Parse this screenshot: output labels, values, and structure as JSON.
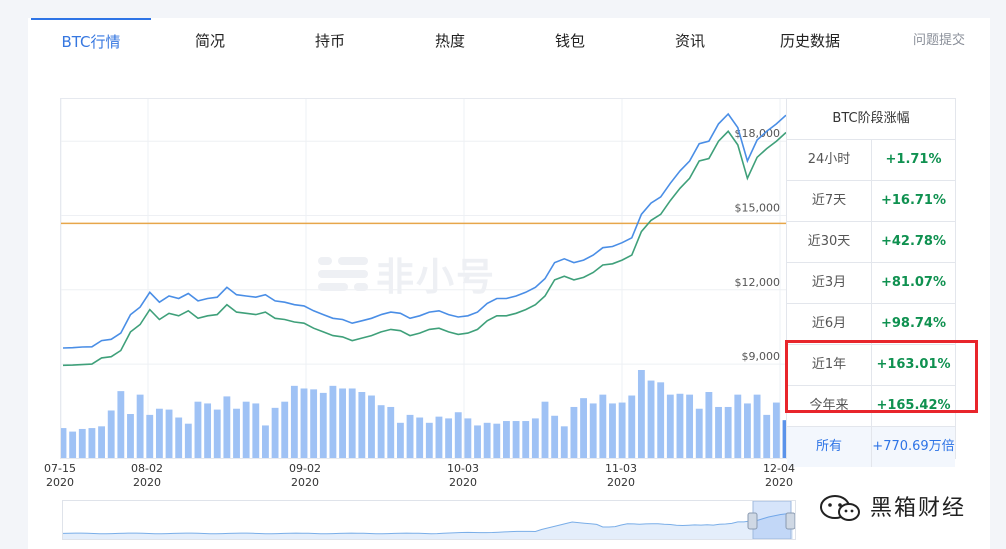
{
  "tabs": [
    {
      "label": "BTC行情",
      "active": true
    },
    {
      "label": "简况"
    },
    {
      "label": "持币"
    },
    {
      "label": "热度"
    },
    {
      "label": "钱包"
    },
    {
      "label": "资讯"
    },
    {
      "label": "历史数据"
    }
  ],
  "help_link": "问题提交",
  "watermark": "非小号",
  "performance": {
    "title": "BTC阶段涨幅",
    "rows": [
      {
        "label": "24小时",
        "value": "+1.71%"
      },
      {
        "label": "近7天",
        "value": "+16.71%"
      },
      {
        "label": "近30天",
        "value": "+42.78%"
      },
      {
        "label": "近3月",
        "value": "+81.07%"
      },
      {
        "label": "近6月",
        "value": "+98.74%"
      },
      {
        "label": "近1年",
        "value": "+163.01%"
      },
      {
        "label": "今年来",
        "value": "+165.42%"
      },
      {
        "label": "所有",
        "value": "+770.69万倍"
      }
    ],
    "highlighted_rows": [
      "近1年",
      "今年来"
    ],
    "highlight_color": "#e8252b",
    "positive_color": "#0f9150"
  },
  "brand": "黑箱财经",
  "colors": {
    "price_line": "#4a8ee6",
    "secondary_line": "#3fa07a",
    "reference_line": "#e7a64a",
    "volume_bar": "#9fc2f5",
    "volume_bar_last": "#5b93ea",
    "accent": "#2e74e6"
  },
  "chart_data": {
    "type": "line",
    "title": "",
    "y_ticks": [
      "$9,000",
      "$12,000",
      "$15,000",
      "$18,000"
    ],
    "ylim": [
      8600,
      19300
    ],
    "x_ticks": [
      {
        "date": "07-15",
        "year": "2020"
      },
      {
        "date": "08-02",
        "year": "2020"
      },
      {
        "date": "09-02",
        "year": "2020"
      },
      {
        "date": "10-03",
        "year": "2020"
      },
      {
        "date": "11-03",
        "year": "2020"
      },
      {
        "date": "12-04",
        "year": "2020"
      }
    ],
    "reference_level": 14680,
    "series": [
      {
        "values": [
          9650,
          9660,
          9690,
          9700,
          9950,
          10000,
          10250,
          11000,
          11300,
          11900,
          11500,
          11750,
          11650,
          11850,
          11550,
          11650,
          11700,
          12100,
          11800,
          11750,
          11700,
          11800,
          11550,
          11500,
          11400,
          11350,
          11150,
          11000,
          10850,
          10800,
          10650,
          10750,
          10850,
          11000,
          11100,
          11050,
          10850,
          10950,
          11100,
          11150,
          11000,
          10900,
          10950,
          11100,
          11450,
          11650,
          11650,
          11750,
          11900,
          12100,
          12450,
          13100,
          13250,
          13100,
          13200,
          13400,
          13700,
          13750,
          13900,
          14100,
          15050,
          15500,
          15750,
          16300,
          16800,
          17200,
          17900,
          18000,
          18700,
          19100,
          18550,
          17200,
          18050,
          18400,
          18700,
          19050
        ]
      },
      {
        "values": [
          8950,
          8960,
          8980,
          9000,
          9250,
          9300,
          9550,
          10300,
          10600,
          11200,
          10800,
          11050,
          10950,
          11150,
          10850,
          10950,
          11000,
          11400,
          11100,
          11050,
          11000,
          11100,
          10850,
          10800,
          10700,
          10650,
          10450,
          10300,
          10150,
          10100,
          9950,
          10050,
          10150,
          10300,
          10400,
          10350,
          10150,
          10250,
          10400,
          10450,
          10300,
          10200,
          10250,
          10400,
          10750,
          10950,
          10950,
          11050,
          11200,
          11400,
          11750,
          12400,
          12550,
          12400,
          12500,
          12700,
          13000,
          13050,
          13200,
          13400,
          14350,
          14800,
          15050,
          15600,
          16100,
          16500,
          17200,
          17300,
          18000,
          18400,
          17850,
          16500,
          17350,
          17700,
          18000,
          18350
        ]
      }
    ],
    "volume": [
      0.34,
      0.3,
      0.33,
      0.34,
      0.36,
      0.54,
      0.76,
      0.5,
      0.72,
      0.49,
      0.56,
      0.55,
      0.46,
      0.39,
      0.64,
      0.62,
      0.55,
      0.7,
      0.56,
      0.64,
      0.62,
      0.37,
      0.57,
      0.64,
      0.82,
      0.79,
      0.78,
      0.74,
      0.82,
      0.79,
      0.79,
      0.75,
      0.71,
      0.6,
      0.58,
      0.4,
      0.49,
      0.46,
      0.4,
      0.47,
      0.45,
      0.52,
      0.45,
      0.37,
      0.4,
      0.39,
      0.42,
      0.42,
      0.42,
      0.45,
      0.64,
      0.48,
      0.36,
      0.58,
      0.68,
      0.62,
      0.72,
      0.62,
      0.63,
      0.71,
      1.0,
      0.88,
      0.86,
      0.72,
      0.73,
      0.72,
      0.56,
      0.75,
      0.58,
      0.58,
      0.72,
      0.62,
      0.72,
      0.49,
      0.63,
      0.43
    ]
  }
}
